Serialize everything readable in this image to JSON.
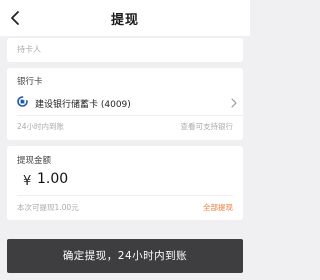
{
  "nav": {
    "title": "提现"
  },
  "holder": {
    "label": "持卡人",
    "name": ""
  },
  "bank": {
    "section_label": "银行卡",
    "bank_name": "建设银行储蓄卡 (4009)",
    "arrival_note": "24小时内到账",
    "supported_link": "查看可支持银行"
  },
  "amount": {
    "section_label": "提现金额",
    "currency": "¥",
    "value": "1.00",
    "available_note": "本次可提现1.00元",
    "withdraw_all": "全部提现"
  },
  "confirm": {
    "label": "确定提现，24小时内到账"
  },
  "colors": {
    "accent_orange": "#ef7a37",
    "button_dark": "#3e3e40",
    "bank_blue": "#1f57a8"
  },
  "icons": {
    "back": "chevron-left-icon",
    "bank": "ccb-bank-logo-icon",
    "row_arrow": "chevron-right-icon"
  }
}
